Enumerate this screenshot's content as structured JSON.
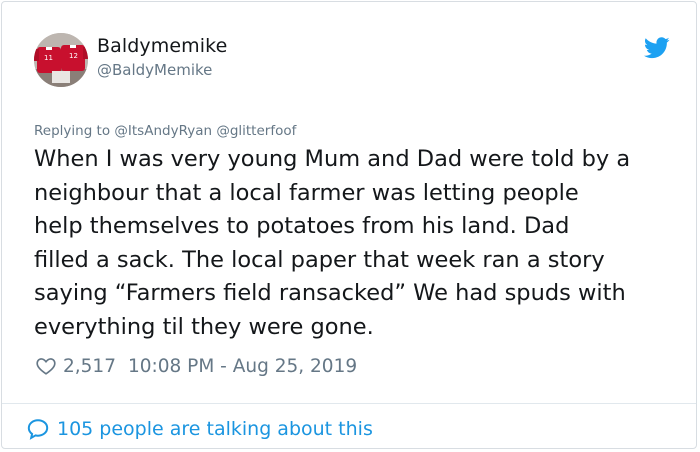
{
  "user": {
    "display_name": "Baldymemike",
    "handle": "@BaldyMemike",
    "avatar_icon": "avatar-football-shirts"
  },
  "reply": {
    "prefix": "Replying to",
    "mentions": "@ItsAndyRyan @glitterfoof"
  },
  "tweet": {
    "lines": [
      "When I was very young Mum and Dad were told by a",
      "neighbour that a local farmer was letting people",
      "help themselves to potatoes from his land. Dad",
      "filled a sack. The local paper that week ran a story",
      "saying “Farmers field ransacked” We had spuds with",
      "everything til they were gone."
    ]
  },
  "meta": {
    "likes": "2,517",
    "timestamp": "10:08 PM - Aug 25, 2019"
  },
  "footer": {
    "talking": "105 people are talking about this"
  },
  "colors": {
    "twitter_blue": "#1da1f2",
    "link_blue": "#1b95e0",
    "muted": "#657786",
    "text": "#14171a"
  }
}
